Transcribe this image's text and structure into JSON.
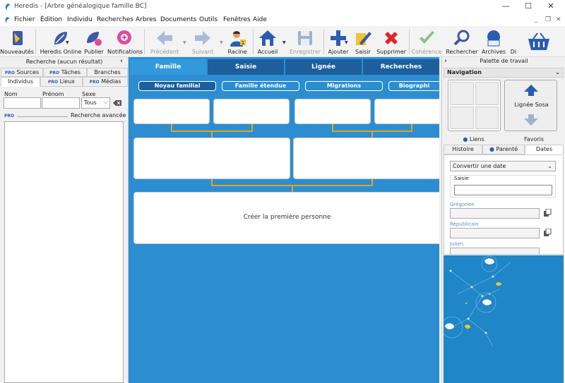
{
  "window": {
    "title": "Heredis - [Arbre généalogique famille BC]",
    "controls": {
      "minimize": "—",
      "maximize": "☐",
      "close": "✕"
    }
  },
  "menu": {
    "items": [
      "Fichier",
      "Édition",
      "Individu",
      "Recherches",
      "Arbres",
      "Documents",
      "Outils",
      "Fenêtres",
      "Aide"
    ],
    "mdi": {
      "minimize": "_",
      "restore": "❐",
      "close": "✕"
    }
  },
  "toolbar": {
    "buttons": [
      {
        "label": "Nouveautés",
        "icon": "news-icon",
        "enabled": true
      },
      {
        "label": "Heredis Online",
        "icon": "online-leaf-icon",
        "enabled": true
      },
      {
        "label": "Publier",
        "icon": "publish-icon",
        "enabled": true
      },
      {
        "label": "Notifications",
        "icon": "notifications-icon",
        "enabled": true
      },
      {
        "label": "Précédent",
        "icon": "arrow-left-icon",
        "enabled": false
      },
      {
        "label": "Suivant",
        "icon": "arrow-right-icon",
        "enabled": false
      },
      {
        "label": "Racine",
        "icon": "root-person-icon",
        "enabled": true
      },
      {
        "label": "Accueil",
        "icon": "home-icon",
        "enabled": true
      },
      {
        "label": "Enregistrer",
        "icon": "save-icon",
        "enabled": false
      },
      {
        "label": "Ajouter",
        "icon": "add-icon",
        "enabled": true
      },
      {
        "label": "Saisir",
        "icon": "edit-icon",
        "enabled": true
      },
      {
        "label": "Supprimer",
        "icon": "delete-icon",
        "enabled": true
      },
      {
        "label": "Cohérence",
        "icon": "check-icon",
        "enabled": false
      },
      {
        "label": "Rechercher",
        "icon": "search-icon",
        "enabled": true
      },
      {
        "label": "Archives",
        "icon": "archives-icon",
        "enabled": true
      },
      {
        "label": "Di",
        "icon": "",
        "enabled": true
      }
    ]
  },
  "left_panel": {
    "header": "Recherche (aucun résultat)",
    "tabs_row1": [
      {
        "pro": "PRO",
        "label": "Sources"
      },
      {
        "pro": "PRO",
        "label": "Tâches"
      },
      {
        "pro": "",
        "label": "Branches"
      }
    ],
    "tabs_row2": [
      {
        "pro": "",
        "label": "Individus"
      },
      {
        "pro": "PRO",
        "label": "Lieux"
      },
      {
        "pro": "PRO",
        "label": "Médias"
      }
    ],
    "fields": {
      "nom": "Nom",
      "prenom": "Prénom",
      "sexe": "Sexe",
      "sexe_value": "Tous"
    },
    "advanced": {
      "pro": "PRO",
      "label": "Recherche avancée"
    }
  },
  "center": {
    "tabs": [
      "Famille",
      "Saisie",
      "Lignée",
      "Recherches"
    ],
    "subtabs": [
      "Noyau familial",
      "Famille étendue",
      "Migrations",
      "Biographi"
    ],
    "create_label": "Créer la première personne"
  },
  "right_panel": {
    "header": "Palette de travail",
    "navigation": "Navigation",
    "lignee_sosa": "Lignée Sosa",
    "tabs_row1": [
      "Liens",
      "Favoris"
    ],
    "tabs_row2": [
      "Histoire",
      "Parenté",
      "Dates"
    ],
    "convert_select": "Convertir une date",
    "saisie_label": "Saisie",
    "calendars": [
      "Grégorien",
      "Républicain",
      "Julien"
    ]
  },
  "colors": {
    "accent": "#2c8ed0",
    "tab_dark": "#1c5f9c",
    "connector": "#e8a21a",
    "pro_badge": "#2a5db0"
  }
}
